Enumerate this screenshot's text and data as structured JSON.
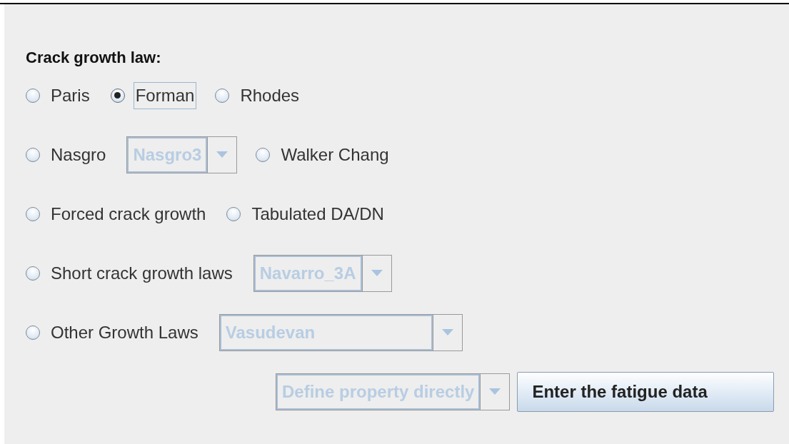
{
  "panel": {
    "title": "Crack growth law:",
    "rows": [
      [
        {
          "kind": "radio",
          "label": "Paris",
          "selected": false,
          "focused": false
        },
        {
          "kind": "radio",
          "label": "Forman",
          "selected": true,
          "focused": true
        },
        {
          "kind": "radio",
          "label": "Rhodes",
          "selected": false,
          "focused": false
        }
      ],
      [
        {
          "kind": "radio",
          "label": "Nasgro",
          "selected": false,
          "focused": false
        },
        {
          "kind": "combo",
          "value": "Nasgro3",
          "disabled": true
        },
        {
          "kind": "radio",
          "label": "Walker Chang",
          "selected": false,
          "focused": false
        }
      ],
      [
        {
          "kind": "radio",
          "label": "Forced crack growth",
          "selected": false,
          "focused": false
        },
        {
          "kind": "radio",
          "label": "Tabulated DA/DN",
          "selected": false,
          "focused": false
        }
      ],
      [
        {
          "kind": "radio",
          "label": "Short crack growth laws",
          "selected": false,
          "focused": false
        },
        {
          "kind": "combo",
          "value": "Navarro_3A",
          "disabled": true
        }
      ],
      [
        {
          "kind": "radio",
          "label": "Other Growth Laws",
          "selected": false,
          "focused": false
        },
        {
          "kind": "combo",
          "value": "Vasudevan",
          "disabled": true
        }
      ],
      [
        {
          "kind": "combo",
          "value": "Define property directly",
          "disabled": true
        },
        {
          "kind": "button",
          "label": "Enter the fatigue data"
        }
      ]
    ]
  }
}
